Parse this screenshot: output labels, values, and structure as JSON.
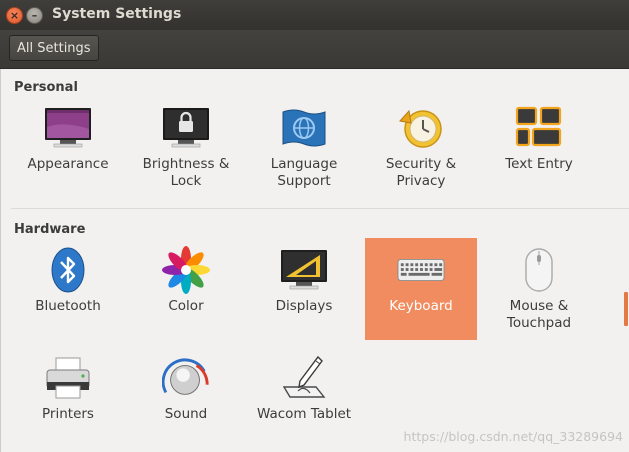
{
  "window": {
    "title": "System Settings"
  },
  "toolbar": {
    "all_settings_label": "All Settings"
  },
  "sections": {
    "personal": {
      "title": "Personal",
      "items": [
        {
          "label": "Appearance",
          "icon": "appearance-icon"
        },
        {
          "label": "Brightness &\nLock",
          "icon": "brightness-lock-icon"
        },
        {
          "label": "Language\nSupport",
          "icon": "language-support-icon"
        },
        {
          "label": "Security &\nPrivacy",
          "icon": "security-privacy-icon"
        },
        {
          "label": "Text Entry",
          "icon": "text-entry-icon"
        }
      ]
    },
    "hardware": {
      "title": "Hardware",
      "items": [
        {
          "label": "Bluetooth",
          "icon": "bluetooth-icon"
        },
        {
          "label": "Color",
          "icon": "color-icon"
        },
        {
          "label": "Displays",
          "icon": "displays-icon"
        },
        {
          "label": "Keyboard",
          "icon": "keyboard-icon",
          "selected": true
        },
        {
          "label": "Mouse &\nTouchpad",
          "icon": "mouse-icon"
        },
        {
          "label": "Printers",
          "icon": "printers-icon"
        },
        {
          "label": "Sound",
          "icon": "sound-icon"
        },
        {
          "label": "Wacom Tablet",
          "icon": "wacom-tablet-icon"
        }
      ]
    }
  },
  "watermark": "https://blog.csdn.net/qq_33289694",
  "colors": {
    "selection": "#f08c5f",
    "titlebar": "#3a3935",
    "close": "#e05a2b"
  }
}
